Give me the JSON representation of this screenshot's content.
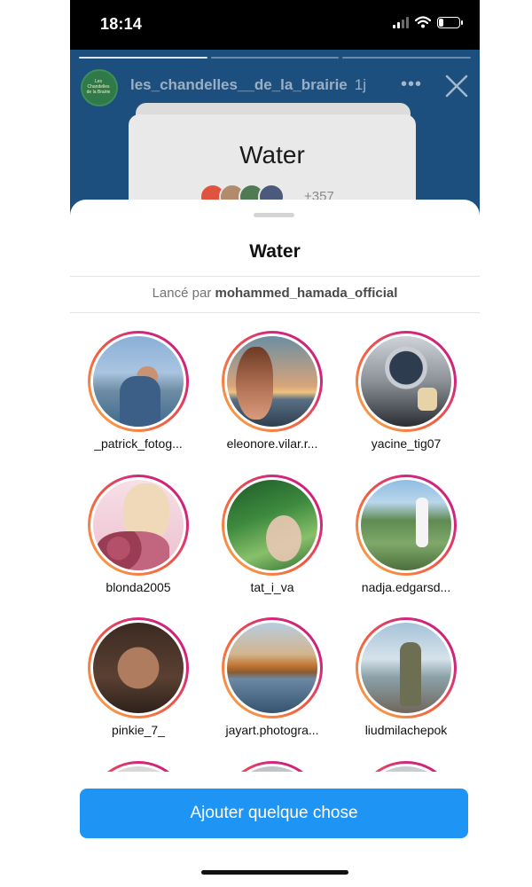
{
  "status_bar": {
    "time": "18:14"
  },
  "story": {
    "username": "les_chandelles__de_la_brairie",
    "age": "1j",
    "more_label": "•••",
    "avatar_text": "Les Chandelles de la Brairie",
    "card_title": "Water",
    "card_count": "+357"
  },
  "sheet": {
    "title": "Water",
    "launched_prefix": "Lancé par",
    "launched_user": "mohammed_hamada_official",
    "participants": [
      {
        "username": "_patrick_fotog...",
        "picture": "man-back-mountains"
      },
      {
        "username": "eleonore.vilar.r...",
        "picture": "woman-sunset-sea"
      },
      {
        "username": "yacine_tig07",
        "picture": "motorcycle-helmet"
      },
      {
        "username": "blonda2005",
        "picture": "illustration-woman-roses"
      },
      {
        "username": "tat_i_va",
        "picture": "face-behind-leaves"
      },
      {
        "username": "nadja.edgarsd...",
        "picture": "woman-valley-village"
      },
      {
        "username": "pinkie_7_",
        "picture": "woman-portrait"
      },
      {
        "username": "jayart.photogra...",
        "picture": "autumn-lake"
      },
      {
        "username": "liudmilachepok",
        "picture": "woman-coat-terrace"
      }
    ],
    "add_button_label": "Ajouter quelque chose"
  },
  "colors": {
    "accent": "#1e95f5",
    "story_background": "#1d4f7e",
    "ring_start": "#f9b24a",
    "ring_end": "#c81f6f"
  }
}
